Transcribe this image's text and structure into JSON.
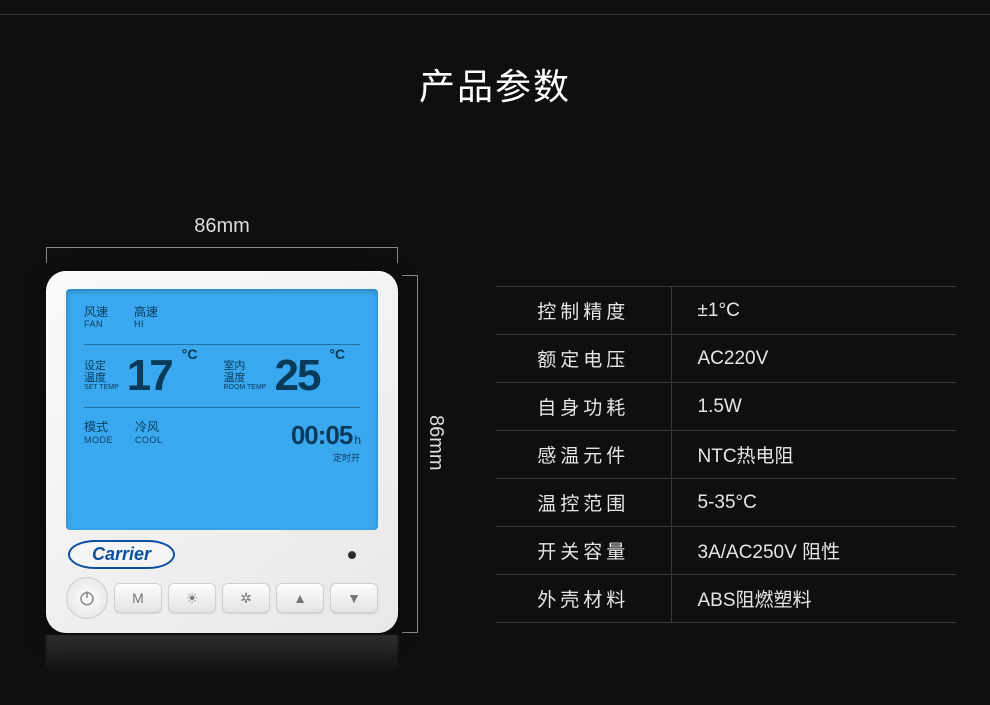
{
  "title": "产品参数",
  "dimensions": {
    "width_label": "86mm",
    "height_label": "86mm"
  },
  "device": {
    "brand": "Carrier",
    "lcd": {
      "fan": {
        "cn": "风速",
        "en": "FAN"
      },
      "fan_level": {
        "cn": "高速",
        "en": "HI"
      },
      "set_temp_label": {
        "cn1": "设定",
        "cn2": "温度",
        "en": "SET TEMP"
      },
      "set_temp_value": "17",
      "room_temp_label": {
        "cn1": "室内",
        "cn2": "温度",
        "en": "ROOM TEMP"
      },
      "room_temp_value": "25",
      "deg": "°C",
      "mode": {
        "cn": "模式",
        "en": "MODE"
      },
      "mode_value": {
        "cn": "冷风",
        "en": "COOL"
      },
      "timer_value": "00:05",
      "timer_unit": "h",
      "timer_sub": "定时开"
    },
    "buttons": {
      "power": "⏻",
      "mode": "M",
      "sun": "☀",
      "fan": "✲",
      "up": "▲",
      "down": "▼"
    }
  },
  "specs": [
    {
      "label": "控制精度",
      "value": "±1°C"
    },
    {
      "label": "额定电压",
      "value": "AC220V"
    },
    {
      "label": "自身功耗",
      "value": "1.5W"
    },
    {
      "label": "感温元件",
      "value": "NTC热电阻"
    },
    {
      "label": "温控范围",
      "value": "5-35°C"
    },
    {
      "label": "开关容量",
      "value": "3A/AC250V 阻性"
    },
    {
      "label": "外壳材料",
      "value": "ABS阻燃塑料"
    }
  ]
}
